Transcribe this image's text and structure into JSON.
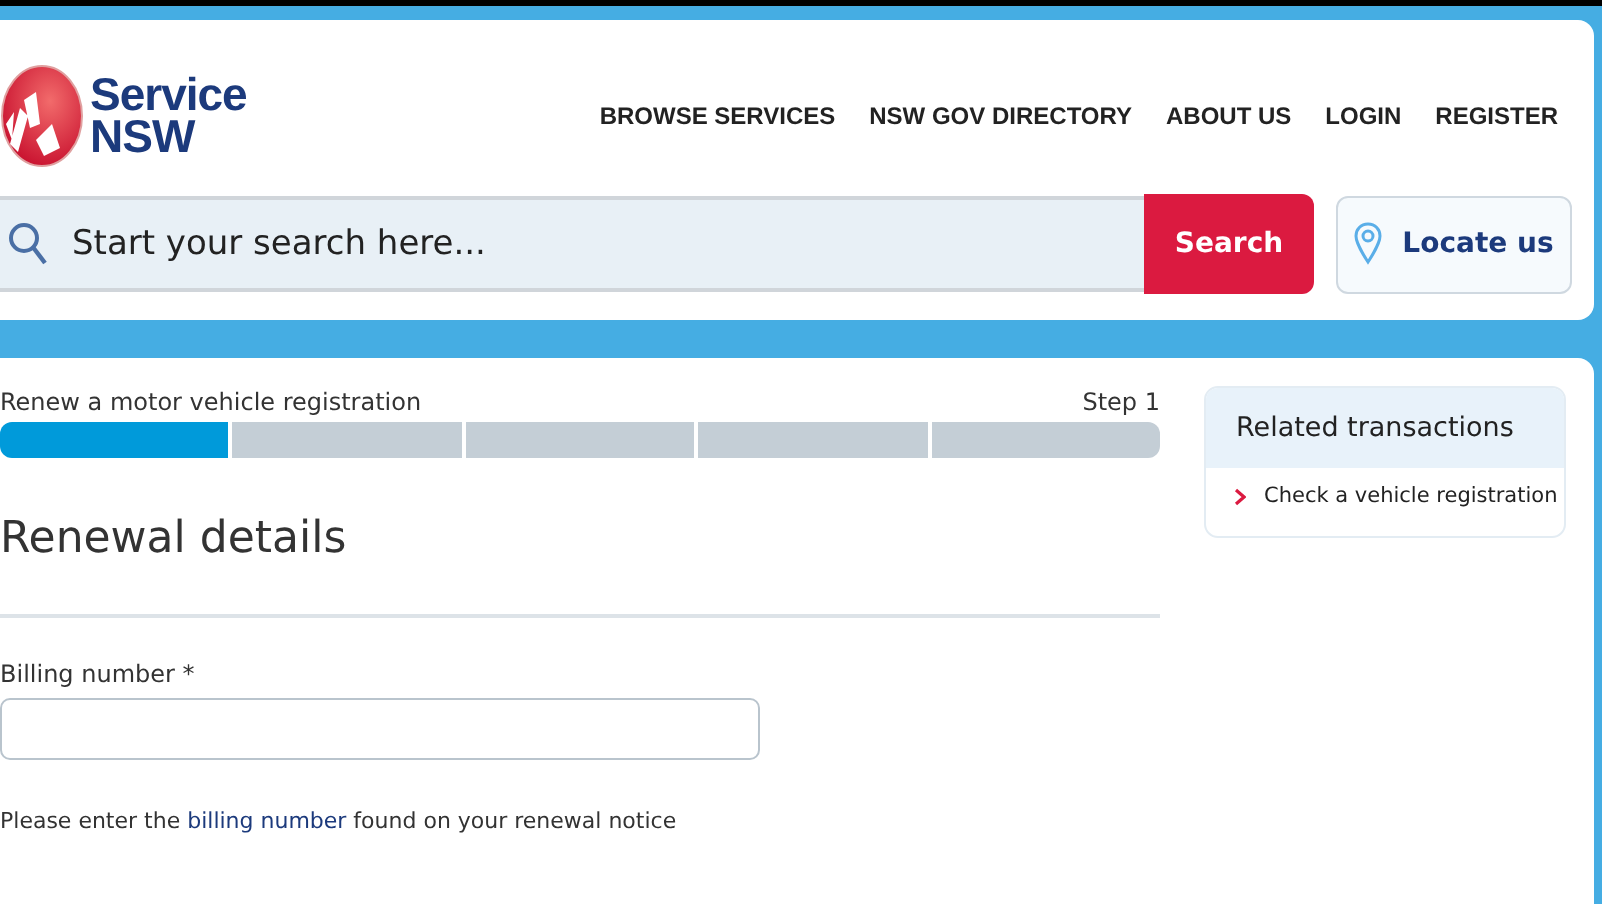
{
  "header": {
    "logo": {
      "line_1": "Service",
      "line_2": "NSW"
    },
    "nav": [
      "BROWSE SERVICES",
      "NSW GOV DIRECTORY",
      "ABOUT US",
      "LOGIN",
      "REGISTER"
    ],
    "search": {
      "placeholder": "Start your search here...",
      "button": "Search"
    },
    "locate": {
      "label": "Locate us"
    }
  },
  "progress": {
    "title": "Renew a motor vehicle registration",
    "step": "Step 1",
    "segments": [
      {
        "complete": true
      },
      {
        "complete": false
      },
      {
        "complete": false
      },
      {
        "complete": false
      },
      {
        "complete": false
      }
    ]
  },
  "form": {
    "heading": "Renewal details",
    "field": {
      "label": "Billing number *"
    },
    "hint": {
      "before": "Please enter the ",
      "link": "billing number",
      "after": " found on your renewal notice"
    }
  },
  "related": {
    "title": "Related transactions",
    "links": [
      "Check a vehicle registration"
    ]
  }
}
